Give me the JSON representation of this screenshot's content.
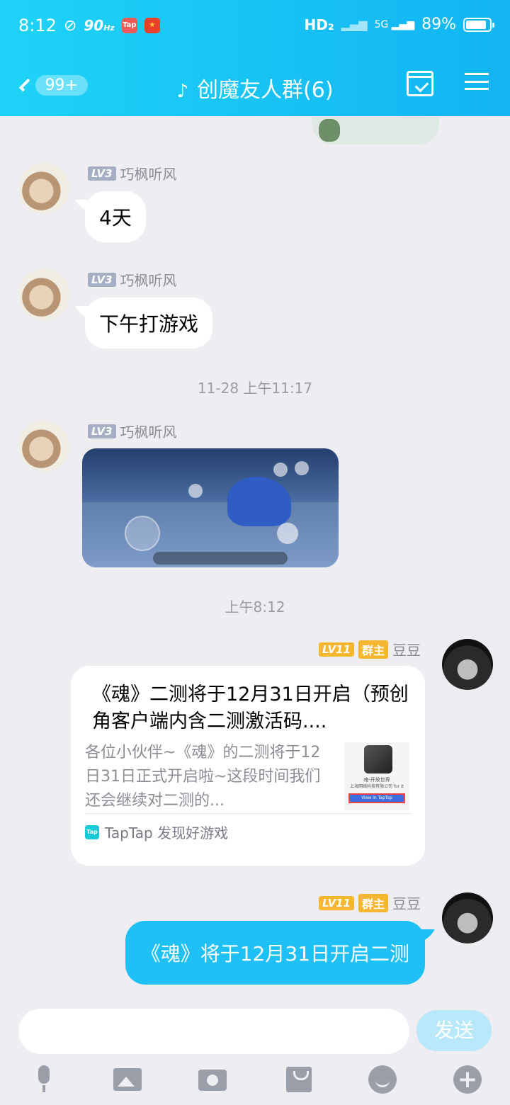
{
  "status_bar": {
    "time": "8:12",
    "refresh": "90",
    "refresh_unit": "Hz",
    "tap_icon": "Tap",
    "network": "HD₂",
    "signal": "5G",
    "battery": "89%"
  },
  "header": {
    "unread_badge": "99+",
    "title": "创魔友人群(6)",
    "icons": [
      "back-chevron-icon",
      "ear-icon",
      "calendar-check-icon",
      "menu-icon"
    ]
  },
  "messages": [
    {
      "level": "LV3",
      "sender": "巧枫听风",
      "text": "4天"
    },
    {
      "level": "LV3",
      "sender": "巧枫听风",
      "text": "下午打游戏"
    },
    {
      "timestamp": "11-28 上午11:17"
    },
    {
      "level": "LV3",
      "sender": "巧枫听风",
      "type": "image"
    },
    {
      "timestamp": "上午8:12"
    },
    {
      "level": "LV11",
      "role": "群主",
      "sender": "豆豆",
      "type": "link-card",
      "title": "《魂》二测将于12月31日开启（预创角客户端内含二测激活码....",
      "summary": "各位小伙伴~《魂》的二测将于12日31日正式开启啦~这段时间我们还会继续对二测的...",
      "thumb_line1": "魂-开放世界",
      "thumb_line2": "上海网络科技有限公司 for it",
      "thumb_button": "View in TapTap",
      "source": "TapTap 发现好游戏"
    },
    {
      "level": "LV11",
      "role": "群主",
      "sender": "豆豆",
      "text": "《魂》将于12月31日开启二测"
    }
  ],
  "input": {
    "value": "",
    "send_label": "发送"
  },
  "toolbar": [
    "microphone-icon",
    "image-icon",
    "camera-icon",
    "red-packet-icon",
    "emoji-icon",
    "plus-icon"
  ]
}
